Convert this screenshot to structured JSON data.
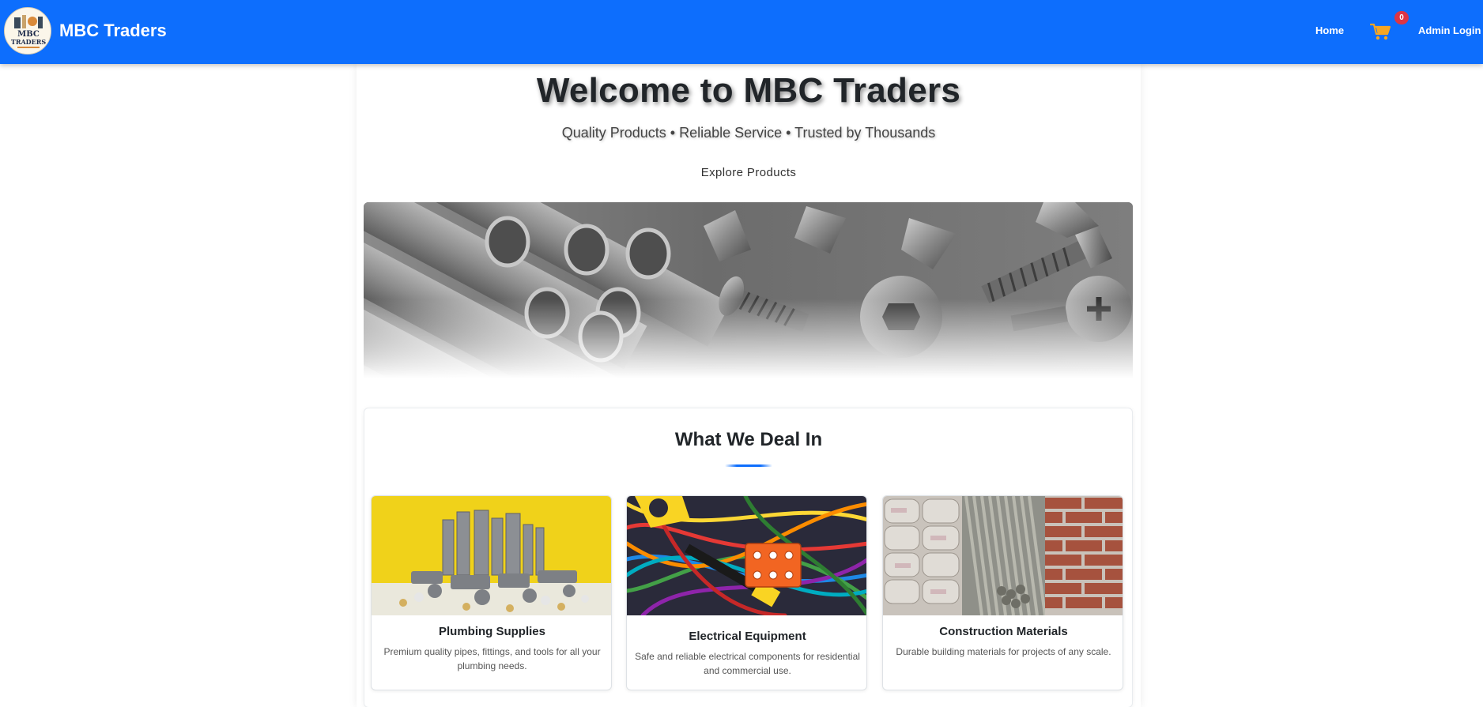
{
  "brand": {
    "name": "MBC Traders",
    "logo_text": "MBC TRADERS"
  },
  "nav": {
    "home_label": "Home",
    "cart_count": "0",
    "admin_label": "Admin Login"
  },
  "hero": {
    "title": "Welcome to MBC Traders",
    "tagline": "Quality Products • Reliable Service • Trusted by Thousands",
    "cta_label": "Explore Products"
  },
  "deal": {
    "title": "What We Deal In",
    "cards": [
      {
        "title": "Plumbing Supplies",
        "description": "Premium quality pipes, fittings, and tools for all your plumbing needs."
      },
      {
        "title": "Electrical Equipment",
        "description": "Safe and reliable electrical components for residential and commercial use."
      },
      {
        "title": "Construction Materials",
        "description": "Durable building materials for projects of any scale."
      }
    ]
  },
  "colors": {
    "primary": "#0d6efd",
    "badge": "#dc3545",
    "cart_icon": "#f5a623"
  }
}
